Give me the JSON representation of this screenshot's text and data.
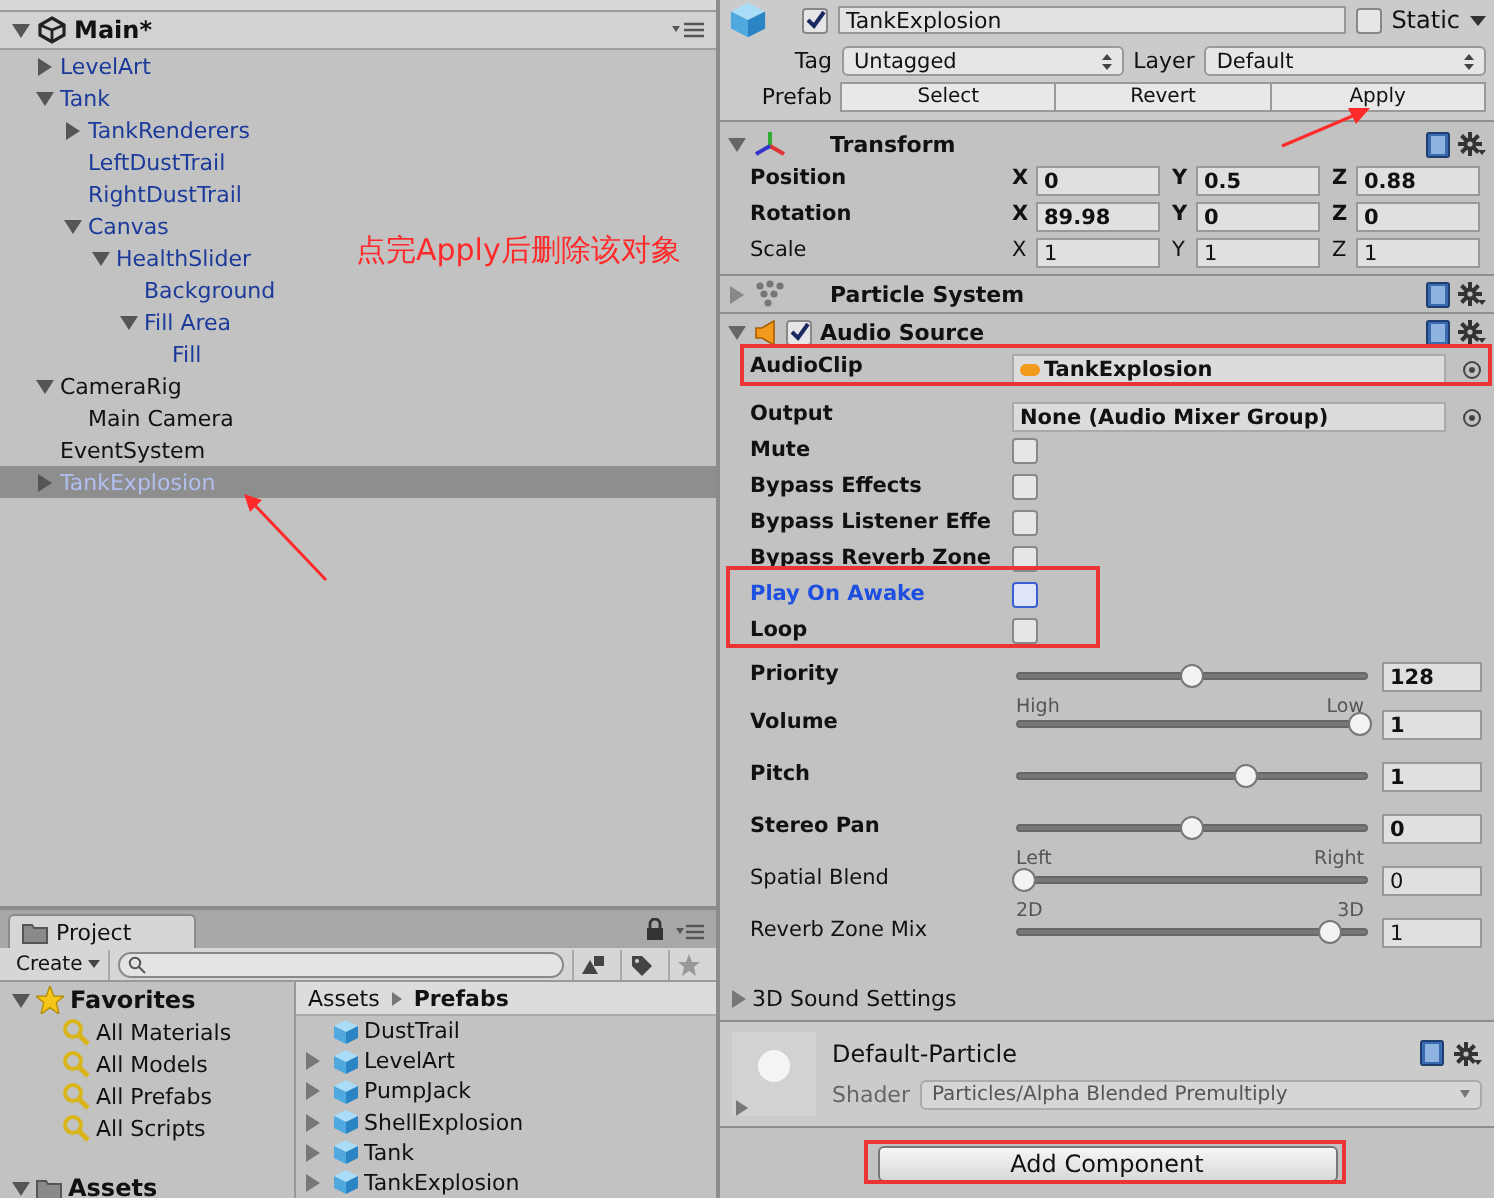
{
  "hierarchy": {
    "scene": "Main*",
    "items": [
      {
        "label": "LevelArt",
        "prefab": true,
        "selected": false,
        "expanded": false
      },
      {
        "label": "Tank",
        "prefab": true,
        "selected": false,
        "expanded": true,
        "children": [
          {
            "label": "TankRenderers",
            "prefab": true,
            "selected": false,
            "expanded": false
          },
          {
            "label": "LeftDustTrail",
            "prefab": true,
            "selected": false
          },
          {
            "label": "RightDustTrail",
            "prefab": true,
            "selected": false
          },
          {
            "label": "Canvas",
            "prefab": true,
            "selected": false,
            "expanded": true,
            "children": [
              {
                "label": "HealthSlider",
                "prefab": true,
                "selected": false,
                "expanded": true,
                "children": [
                  {
                    "label": "Background",
                    "prefab": true,
                    "selected": false
                  },
                  {
                    "label": "Fill Area",
                    "prefab": true,
                    "selected": false,
                    "expanded": true,
                    "children": [
                      {
                        "label": "Fill",
                        "prefab": true,
                        "selected": false
                      }
                    ]
                  }
                ]
              }
            ]
          }
        ]
      },
      {
        "label": "CameraRig",
        "prefab": false,
        "selected": false,
        "expanded": true,
        "children": [
          {
            "label": "Main Camera",
            "prefab": false,
            "selected": false
          }
        ]
      },
      {
        "label": "EventSystem",
        "prefab": false,
        "selected": false
      },
      {
        "label": "TankExplosion",
        "prefab": true,
        "selected": true,
        "expanded": false
      }
    ]
  },
  "project": {
    "tab": "Project",
    "create": "Create",
    "favorites_title": "Favorites",
    "favorites": [
      "All Materials",
      "All Models",
      "All Prefabs",
      "All Scripts"
    ],
    "assets_title": "Assets",
    "breadcrumb": [
      "Assets",
      "Prefabs"
    ],
    "files": [
      {
        "name": "DustTrail"
      },
      {
        "name": "LevelArt",
        "expanded": false
      },
      {
        "name": "PumpJack",
        "expanded": false
      },
      {
        "name": "ShellExplosion",
        "expanded": false
      },
      {
        "name": "Tank",
        "expanded": false
      },
      {
        "name": "TankExplosion",
        "expanded": false
      }
    ]
  },
  "inspector": {
    "object": {
      "active": true,
      "name": "TankExplosion",
      "static": false,
      "static_label": "Static",
      "tag_label": "Tag",
      "tag": "Untagged",
      "layer_label": "Layer",
      "layer": "Default",
      "prefab_label": "Prefab",
      "prefab_buttons": [
        "Select",
        "Revert",
        "Apply"
      ]
    },
    "transform": {
      "title": "Transform",
      "expanded": true,
      "rows": [
        {
          "label": "Position",
          "bold": true,
          "values": [
            {
              "axis": "X",
              "value": "0"
            },
            {
              "axis": "Y",
              "value": "0.5"
            },
            {
              "axis": "Z",
              "value": "0.88"
            }
          ]
        },
        {
          "label": "Rotation",
          "bold": true,
          "values": [
            {
              "axis": "X",
              "value": "89.98"
            },
            {
              "axis": "Y",
              "value": "0"
            },
            {
              "axis": "Z",
              "value": "0"
            }
          ]
        },
        {
          "label": "Scale",
          "bold": false,
          "values": [
            {
              "axis": "X",
              "value": "1"
            },
            {
              "axis": "Y",
              "value": "1"
            },
            {
              "axis": "Z",
              "value": "1"
            }
          ]
        }
      ]
    },
    "particle_system": {
      "title": "Particle System",
      "expanded": false
    },
    "audio_source": {
      "title": "Audio Source",
      "expanded": true,
      "enabled": true,
      "fields": [
        {
          "kind": "audio-clip",
          "label": "AudioClip",
          "bold": true,
          "value": "TankExplosion"
        },
        {
          "kind": "object",
          "label": "Output",
          "bold": true,
          "value": "None (Audio Mixer Group)"
        },
        {
          "kind": "checkbox",
          "label": "Mute",
          "bold": true,
          "checked": false,
          "focused": false
        },
        {
          "kind": "checkbox",
          "label": "Bypass Effects",
          "bold": true,
          "checked": false,
          "focused": false
        },
        {
          "kind": "checkbox",
          "label": "Bypass Listener Effe",
          "bold": true,
          "checked": false,
          "focused": false
        },
        {
          "kind": "checkbox",
          "label": "Bypass Reverb Zone",
          "bold": true,
          "checked": false,
          "focused": false
        },
        {
          "kind": "checkbox",
          "label": "Play On Awake",
          "bold": true,
          "checked": false,
          "focused": true
        },
        {
          "kind": "checkbox",
          "label": "Loop",
          "bold": true,
          "checked": false,
          "focused": false
        },
        {
          "kind": "slider",
          "label": "Priority",
          "bold": true,
          "level": 0.5,
          "value": "128",
          "min_label": "High",
          "max_label": "Low"
        },
        {
          "kind": "slider",
          "label": "Volume",
          "bold": true,
          "level": 1,
          "value": "1"
        },
        {
          "kind": "slider",
          "label": "Pitch",
          "bold": true,
          "level": 0.66,
          "value": "1"
        },
        {
          "kind": "slider",
          "label": "Stereo Pan",
          "bold": true,
          "level": 0.5,
          "value": "0",
          "min_label": "Left",
          "max_label": "Right"
        },
        {
          "kind": "slider",
          "label": "Spatial Blend",
          "bold": false,
          "level": 0,
          "value": "0",
          "min_label": "2D",
          "max_label": "3D"
        },
        {
          "kind": "slider",
          "label": "Reverb Zone Mix",
          "bold": false,
          "level": 0.91,
          "value": "1"
        }
      ],
      "subsection": {
        "title": "3D Sound Settings",
        "expanded": false
      }
    },
    "material": {
      "name": "Default-Particle",
      "shader_label": "Shader",
      "shader": "Particles/Alpha Blended Premultiply"
    },
    "add_component": "Add Component"
  },
  "annotation": {
    "note": "点完Apply后删除该对象"
  }
}
